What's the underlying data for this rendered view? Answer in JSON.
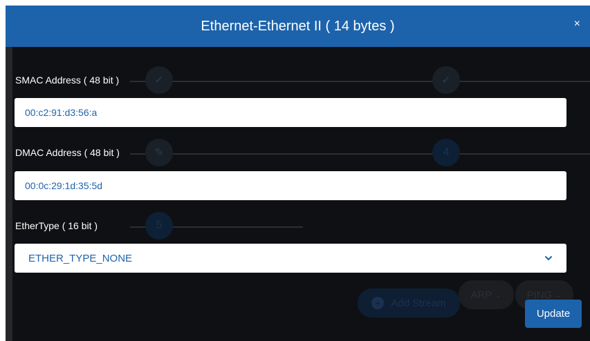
{
  "header": {
    "title": "Ethernet-Ethernet II ( 14 bytes )",
    "close_glyph": "×"
  },
  "fields": {
    "smac": {
      "label": "SMAC Address ( 48 bit )",
      "value": "00:c2:91:d3:56:a"
    },
    "dmac": {
      "label": "DMAC Address ( 48 bit )",
      "value": "00:0c:29:1d:35:5d"
    },
    "ethertype": {
      "label": "EtherType ( 16 bit )",
      "selected": "ETHER_TYPE_NONE"
    }
  },
  "background": {
    "step_check_glyph": "✓",
    "step_edit_glyph": "✎",
    "step_4": "4",
    "step_5": "5",
    "add_stream_label": "Add Stream",
    "arp_label": "ARP",
    "ping_label": "PING",
    "pill_chevron": "⌄"
  },
  "footer": {
    "update_label": "Update"
  },
  "colors": {
    "header_bg": "#1d63ab",
    "modal_bg": "#0f1013",
    "value_text": "#1d63ab"
  }
}
